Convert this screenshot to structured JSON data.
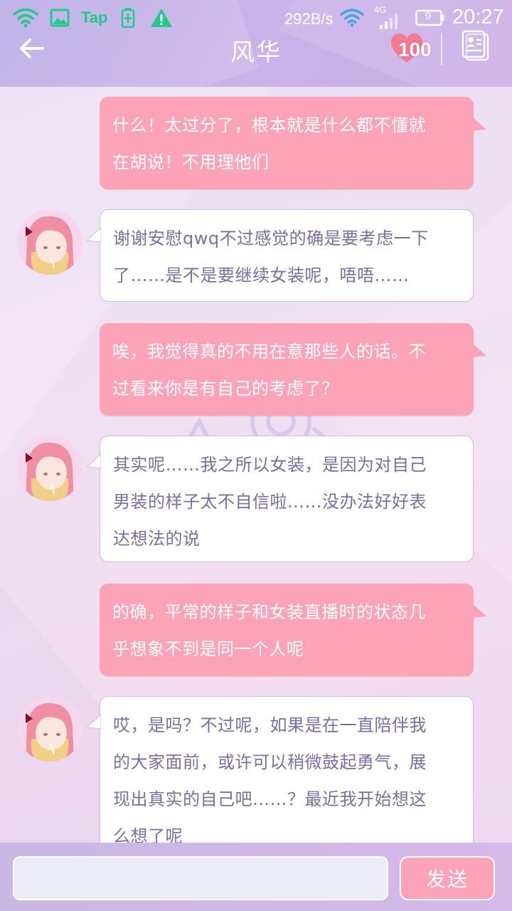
{
  "status_bar": {
    "net_speed": "292B/s",
    "network_type": "4G",
    "battery_level": "9",
    "time": "20:27",
    "tap_label": "Tap",
    "icons": [
      "wifi-icon",
      "image-icon",
      "tap-app-icon",
      "battery-charging-icon",
      "warning-icon",
      "wifi-icon",
      "signal-icon",
      "battery-icon"
    ]
  },
  "header": {
    "title": "风华",
    "affection_value": "100",
    "back_icon": "arrow-left-icon",
    "heart_icon": "heart-icon",
    "profile_icon": "contact-card-icon"
  },
  "messages": [
    {
      "side": "out",
      "lines": [
        "什么！太过分了，根本就是什么都不懂就",
        "在胡说！不用理他们"
      ]
    },
    {
      "side": "in",
      "lines": [
        "谢谢安慰qwq不过感觉的确是要考虑一下",
        "了……是不是要继续女装呢，唔唔……"
      ]
    },
    {
      "side": "out",
      "lines": [
        "唉，我觉得真的不用在意那些人的话。不",
        "过看来你是有自己的考虑了？"
      ]
    },
    {
      "side": "in",
      "lines": [
        "其实呢……我之所以女装，是因为对自己",
        "男装的样子太不自信啦……没办法好好表",
        "达想法的说"
      ]
    },
    {
      "side": "out",
      "lines": [
        "的确，平常的样子和女装直播时的状态几",
        "乎想象不到是同一个人呢"
      ]
    },
    {
      "side": "in",
      "lines": [
        "哎，是吗？不过呢，如果是在一直陪伴我",
        "的大家面前，或许可以稍微鼓起勇气，展",
        "现出真实的自己吧……？最近我开始想这",
        "么想了呢"
      ]
    }
  ],
  "input": {
    "value": "",
    "placeholder": "",
    "send_label": "发送"
  },
  "colors": {
    "out_bubble": "#fda3b7",
    "in_bubble_text": "#7b6ea6",
    "header_bg": "#c4b0e8",
    "status_green": "#22c98a"
  }
}
